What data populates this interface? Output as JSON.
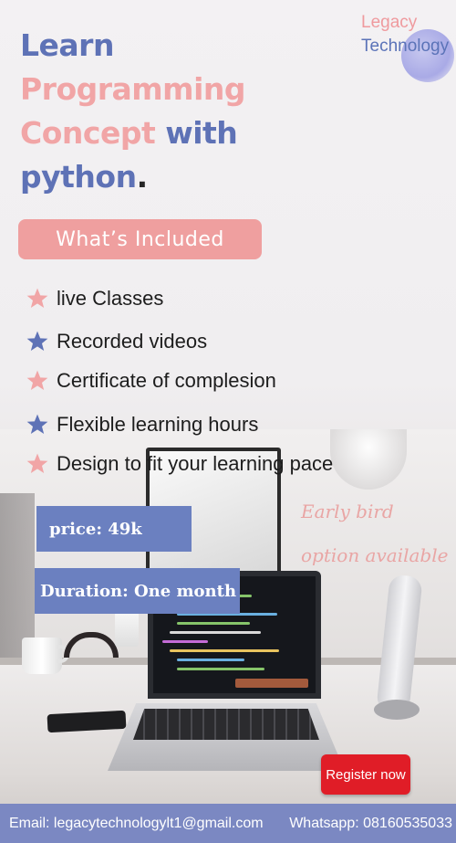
{
  "brand": {
    "line1": "Legacy",
    "line2": "Technology"
  },
  "headline": {
    "line1": "Learn",
    "line2": "Programming",
    "line3_word1": "Concept",
    "line3_word2": "with",
    "line4": "python",
    "line4_end": "."
  },
  "included_label": "What’s Included",
  "features": [
    {
      "label": "live Classes",
      "star_color": "#f1a5a6"
    },
    {
      "label": "Recorded videos",
      "star_color": "#5e72b6"
    },
    {
      "label": "Certificate of complesion",
      "star_color": "#f1a5a6"
    },
    {
      "label": "Flexible learning hours",
      "star_color": "#5e72b6"
    },
    {
      "label": "Design to fit your learning pace",
      "star_color": "#f1a5a6"
    }
  ],
  "price": "price: 49k",
  "duration": "Duration: One month",
  "early_bird": {
    "line1": "Early bird",
    "line2": "option available"
  },
  "register_label": "Register now",
  "footer": {
    "email": "Email: legacytechnologylt1@gmail.com",
    "whatsapp": "Whatsapp: 08160535033"
  },
  "colors": {
    "blue": "#5e72b6",
    "pink": "#f1a5a6",
    "register": "#e01d27",
    "footer": "#7b88c2"
  }
}
